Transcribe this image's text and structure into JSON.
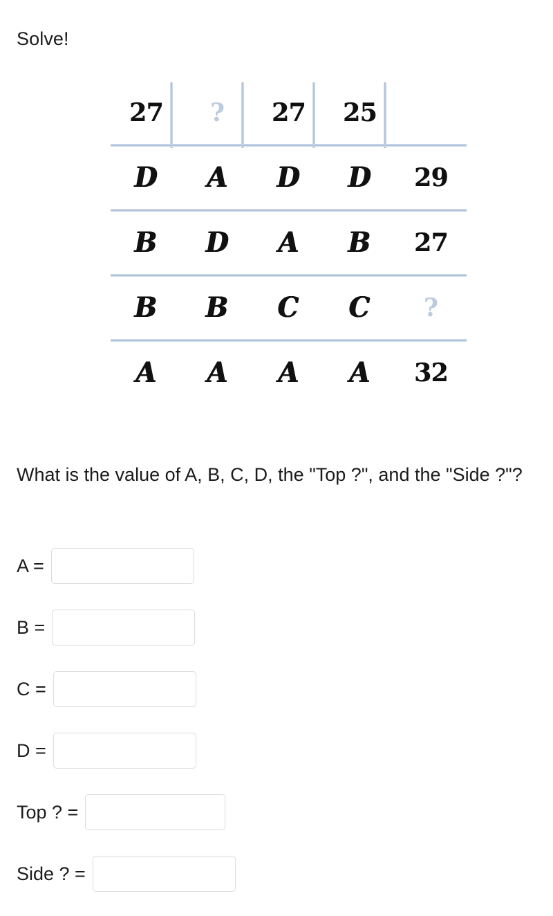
{
  "prompt": "Solve!",
  "puzzle": {
    "type": "table",
    "description": "Letter-sum puzzle grid: 4 letter columns plus a sum column; top row holds column sums, right column holds row sums.",
    "rows": [
      {
        "kind": "column-sums",
        "cells": [
          {
            "text": "27",
            "style": "num"
          },
          {
            "text": "?",
            "style": "question"
          },
          {
            "text": "27",
            "style": "num"
          },
          {
            "text": "25",
            "style": "num"
          },
          {
            "text": "",
            "style": "empty"
          }
        ]
      },
      {
        "kind": "letters",
        "cells": [
          {
            "text": "D",
            "style": "glyph"
          },
          {
            "text": "A",
            "style": "glyph"
          },
          {
            "text": "D",
            "style": "glyph"
          },
          {
            "text": "D",
            "style": "glyph"
          },
          {
            "text": "29",
            "style": "num"
          }
        ]
      },
      {
        "kind": "letters",
        "cells": [
          {
            "text": "B",
            "style": "glyph"
          },
          {
            "text": "D",
            "style": "glyph"
          },
          {
            "text": "A",
            "style": "glyph"
          },
          {
            "text": "B",
            "style": "glyph"
          },
          {
            "text": "27",
            "style": "num"
          }
        ]
      },
      {
        "kind": "letters",
        "cells": [
          {
            "text": "B",
            "style": "glyph"
          },
          {
            "text": "B",
            "style": "glyph"
          },
          {
            "text": "C",
            "style": "glyph"
          },
          {
            "text": "C",
            "style": "glyph"
          },
          {
            "text": "?",
            "style": "question"
          }
        ]
      },
      {
        "kind": "letters",
        "cells": [
          {
            "text": "A",
            "style": "glyph"
          },
          {
            "text": "A",
            "style": "glyph"
          },
          {
            "text": "A",
            "style": "glyph"
          },
          {
            "text": "A",
            "style": "glyph"
          },
          {
            "text": "32",
            "style": "num"
          }
        ]
      }
    ]
  },
  "question": "What is the value of A, B, C, D, the \"Top ?\", and the \"Side ?\"?",
  "answers": [
    {
      "label": "A =",
      "value": "",
      "placeholder": ""
    },
    {
      "label": "B =",
      "value": "",
      "placeholder": ""
    },
    {
      "label": "C =",
      "value": "",
      "placeholder": ""
    },
    {
      "label": "D =",
      "value": "",
      "placeholder": ""
    },
    {
      "label": "Top ? =",
      "value": "",
      "placeholder": ""
    },
    {
      "label": "Side ? =",
      "value": "",
      "placeholder": ""
    }
  ],
  "colors": {
    "grid_line": "#b2c4da",
    "question_mark": "#bccbdd",
    "text": "#1b1b1b",
    "input_border": "#dcdcdc",
    "background": "#ffffff"
  }
}
